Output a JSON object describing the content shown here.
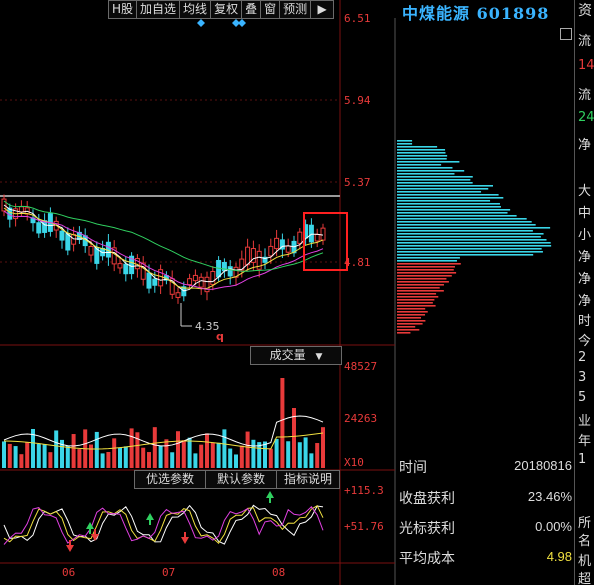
{
  "toolbar": {
    "items": [
      "H股",
      "加自选",
      "均线",
      "复权",
      "叠",
      "窗",
      "预测"
    ],
    "arrow": "▶"
  },
  "stock": {
    "name": "中煤能源",
    "code": "601898"
  },
  "price_axis": [
    "6.51",
    "5.94",
    "5.37",
    "4.81"
  ],
  "low_label": "4.35",
  "low_marker": "q",
  "volume": {
    "label": "成交量",
    "ticks": [
      "48527",
      "24263"
    ],
    "unit": "X10"
  },
  "param_tabs": [
    "优选参数",
    "默认参数",
    "指标说明"
  ],
  "indicator": {
    "ticks": [
      "+115.3",
      "+51.76"
    ]
  },
  "months": [
    "06",
    "07",
    "08"
  ],
  "right_fragments": {
    "top": "资",
    "items": [
      {
        "text": "流",
        "color": "#dddddd"
      },
      {
        "text": "14",
        "color": "#e83a3a"
      },
      {
        "text": "流",
        "color": "#dddddd"
      },
      {
        "text": "24",
        "color": "#30d060"
      },
      {
        "text": "净",
        "color": "#dddddd"
      },
      {
        "text": "大",
        "color": "#dddddd"
      },
      {
        "text": "中",
        "color": "#dddddd"
      },
      {
        "text": "小",
        "color": "#dddddd"
      },
      {
        "text": "净",
        "color": "#dddddd"
      },
      {
        "text": "净",
        "color": "#dddddd"
      },
      {
        "text": "净",
        "color": "#dddddd"
      },
      {
        "text": "时",
        "color": "#dddddd"
      },
      {
        "text": "今",
        "color": "#dddddd"
      },
      {
        "text": "2",
        "color": "#dddddd"
      },
      {
        "text": "3",
        "color": "#dddddd"
      },
      {
        "text": "5",
        "color": "#dddddd"
      },
      {
        "text": "业",
        "color": "#dddddd"
      },
      {
        "text": "年",
        "color": "#dddddd"
      },
      {
        "text": "1",
        "color": "#dddddd"
      },
      {
        "text": "所",
        "color": "#dddddd"
      },
      {
        "text": "名",
        "color": "#dddddd"
      },
      {
        "text": "机",
        "color": "#dddddd"
      },
      {
        "text": "超",
        "color": "#dddddd"
      }
    ]
  },
  "chip_info": {
    "rows": [
      {
        "label": "时间",
        "value": "20180816"
      },
      {
        "label": "收盘获利",
        "value": "23.46%"
      },
      {
        "label": "光标获利",
        "value": "0.00%"
      },
      {
        "label": "平均成本",
        "value": "4.98"
      }
    ]
  },
  "colors": {
    "up": "#e83a3a",
    "down": "#3ad6e8",
    "ma5": "#ffffff",
    "ma10": "#f0e040",
    "ma20": "#e040e0",
    "ma60": "#30d060",
    "title": "#3ab4ff"
  }
}
